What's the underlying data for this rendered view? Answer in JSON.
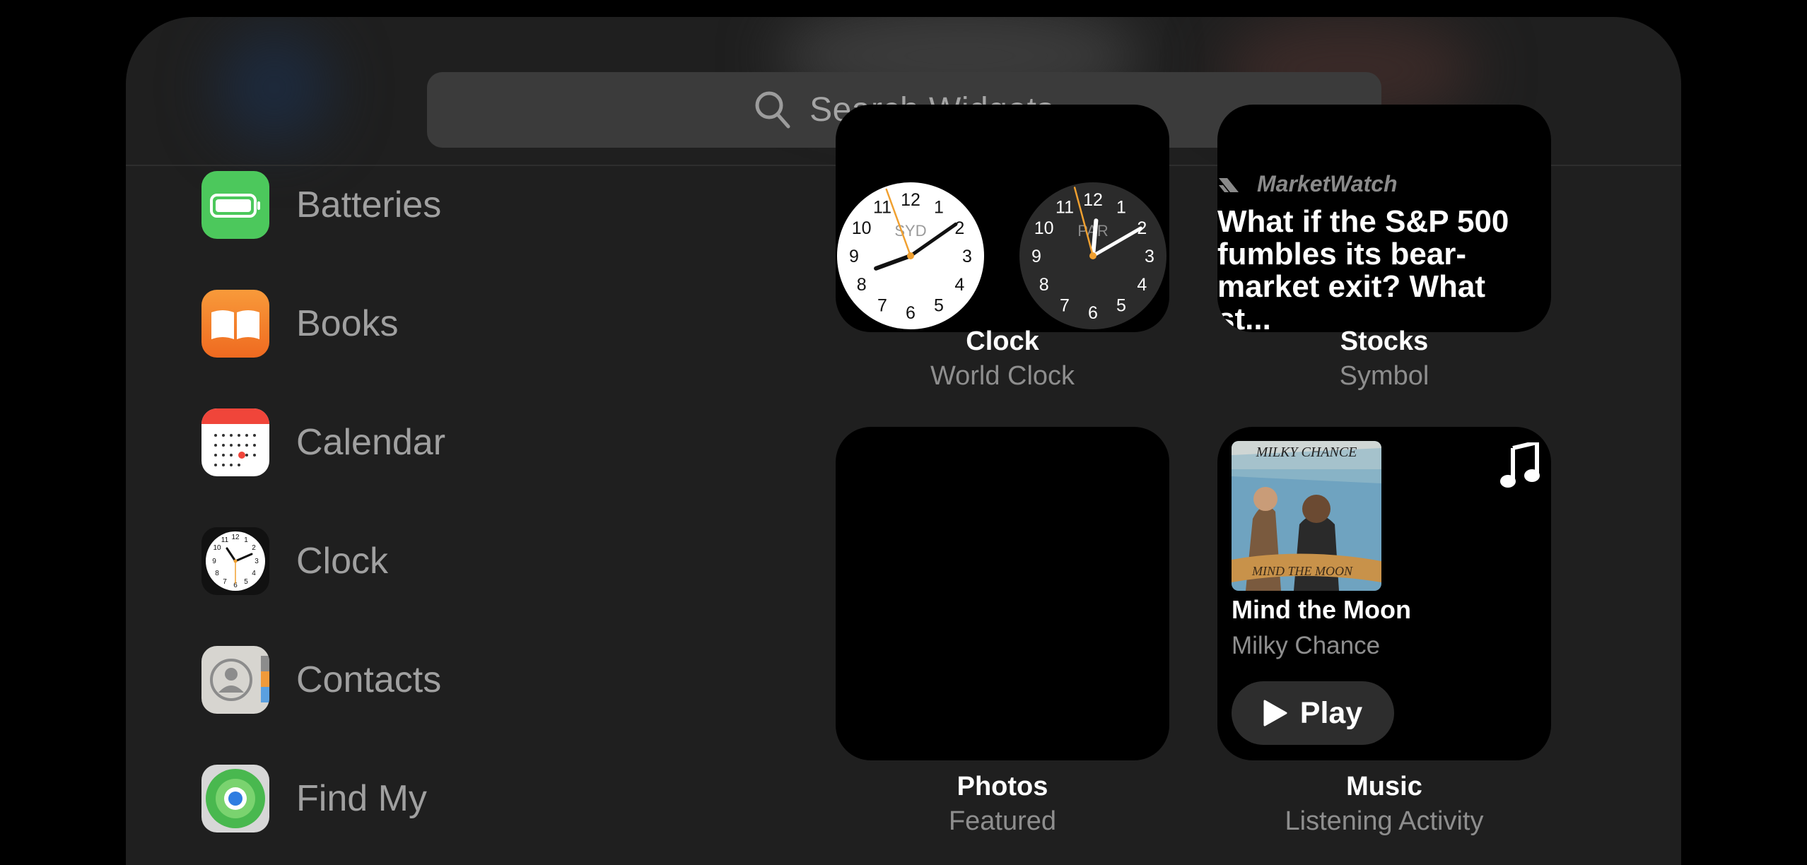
{
  "search": {
    "placeholder": "Search Widgets"
  },
  "apps": [
    {
      "label": "Batteries",
      "icon": "battery-icon"
    },
    {
      "label": "Books",
      "icon": "open-book-icon"
    },
    {
      "label": "Calendar",
      "icon": "calendar-icon"
    },
    {
      "label": "Clock",
      "icon": "clock-icon"
    },
    {
      "label": "Contacts",
      "icon": "person-icon"
    },
    {
      "label": "Find My",
      "icon": "location-icon"
    }
  ],
  "widgets": {
    "clock": {
      "title": "Clock",
      "subtitle": "World Clock",
      "clocks": [
        {
          "city": "SYD",
          "theme": "light",
          "numerals": [
            "12",
            "1",
            "2",
            "3",
            "4",
            "5",
            "6",
            "7",
            "8",
            "9",
            "10",
            "11"
          ]
        },
        {
          "city": "PAR",
          "theme": "dark",
          "numerals": [
            "12",
            "1",
            "2",
            "3",
            "4",
            "5",
            "6",
            "7",
            "8",
            "9",
            "10",
            "11"
          ]
        }
      ]
    },
    "stocks": {
      "title": "Stocks",
      "subtitle": "Symbol",
      "source": "MarketWatch",
      "headline": "What if the S&P 500 fumbles its bear-market exit? What st..."
    },
    "photos": {
      "title": "Photos",
      "subtitle": "Featured"
    },
    "music": {
      "title": "Music",
      "subtitle": "Listening Activity",
      "song": "Mind the Moon",
      "artist": "Milky Chance",
      "play_label": "Play",
      "album_art_text_top": "MILKY CHANCE",
      "album_art_text_bottom": "MIND THE MOON"
    }
  },
  "colors": {
    "sheet": "#1f1f1f",
    "search_field": "#3b3b3b",
    "batteries": "#4cc85c",
    "books": "#f47a2a",
    "clock_second_hand": "#f0a030"
  }
}
